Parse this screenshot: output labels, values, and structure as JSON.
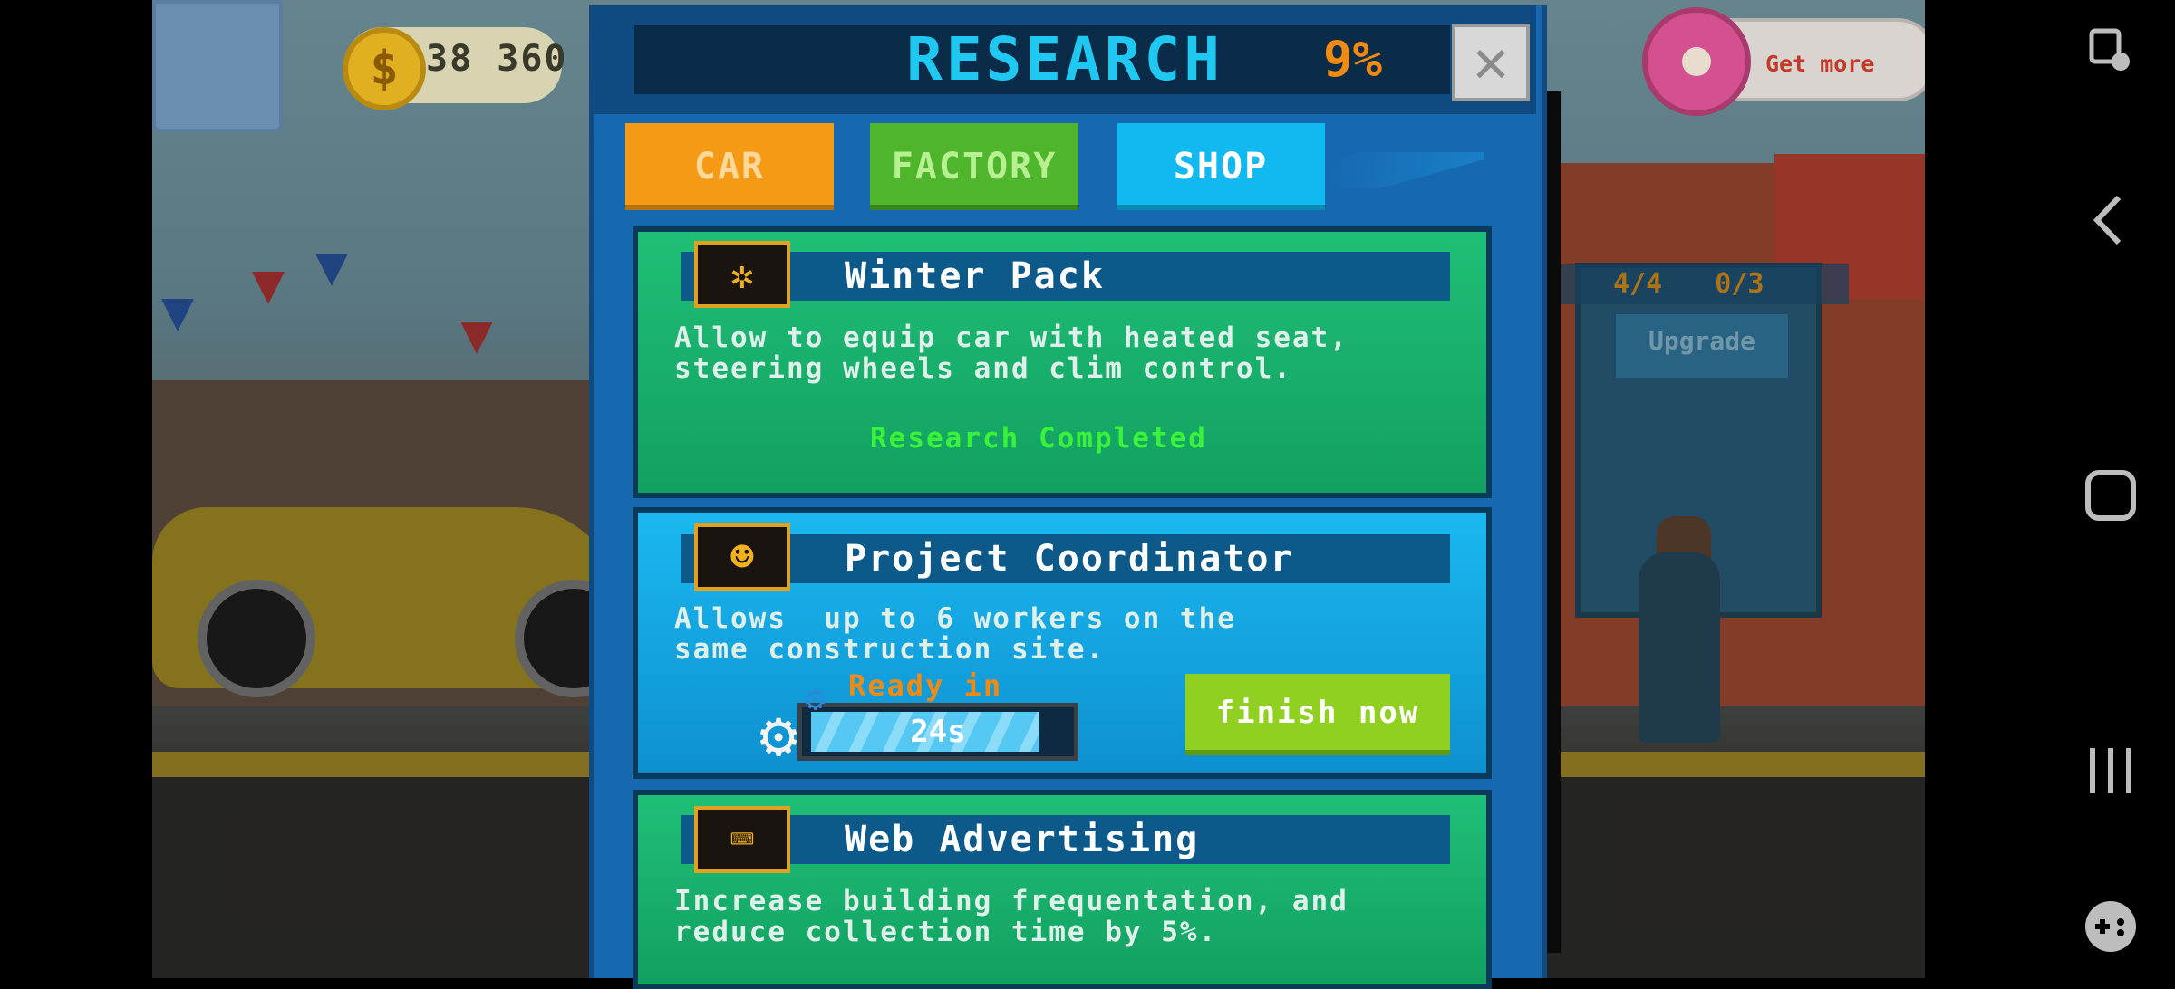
{
  "hud": {
    "coins": "38 360",
    "coin_symbol": "$",
    "get_more": "Get more"
  },
  "background": {
    "counter_cars": "4/4",
    "counter_workers": "0/3",
    "upgrade_label": "Upgrade"
  },
  "research": {
    "title": "RESEARCH",
    "progress": "9%",
    "close_label": "✕",
    "tabs": [
      {
        "label": "CAR",
        "color": "#f59a14"
      },
      {
        "label": "FACTORY",
        "color": "#4eb52c"
      },
      {
        "label": "SHOP",
        "color": "#12b8f0",
        "active": true
      }
    ],
    "items": [
      {
        "title": "Winter Pack",
        "icon": "snowflake-icon",
        "desc_line1": "Allow to equip car with heated seat,",
        "desc_line2": "steering wheels and clim control.",
        "status": "Research Completed"
      },
      {
        "title": "Project Coordinator",
        "icon": "worker-icon",
        "desc_line1": "Allows  up to 6 workers on the",
        "desc_line2": "same construction site.",
        "ready_label": "Ready in",
        "timer": "24s",
        "progress_fraction": 0.9,
        "action": "finish now"
      },
      {
        "title": "Web Advertising",
        "icon": "web-ad-icon",
        "desc_line1": "Increase building frequentation, and",
        "desc_line2": "reduce collection time by 5%."
      }
    ]
  },
  "colors": {
    "accent_cyan": "#1ec8f0",
    "progress_orange": "#f08a10",
    "completed_green": "#3af23a",
    "finish_button": "#8fd020"
  }
}
